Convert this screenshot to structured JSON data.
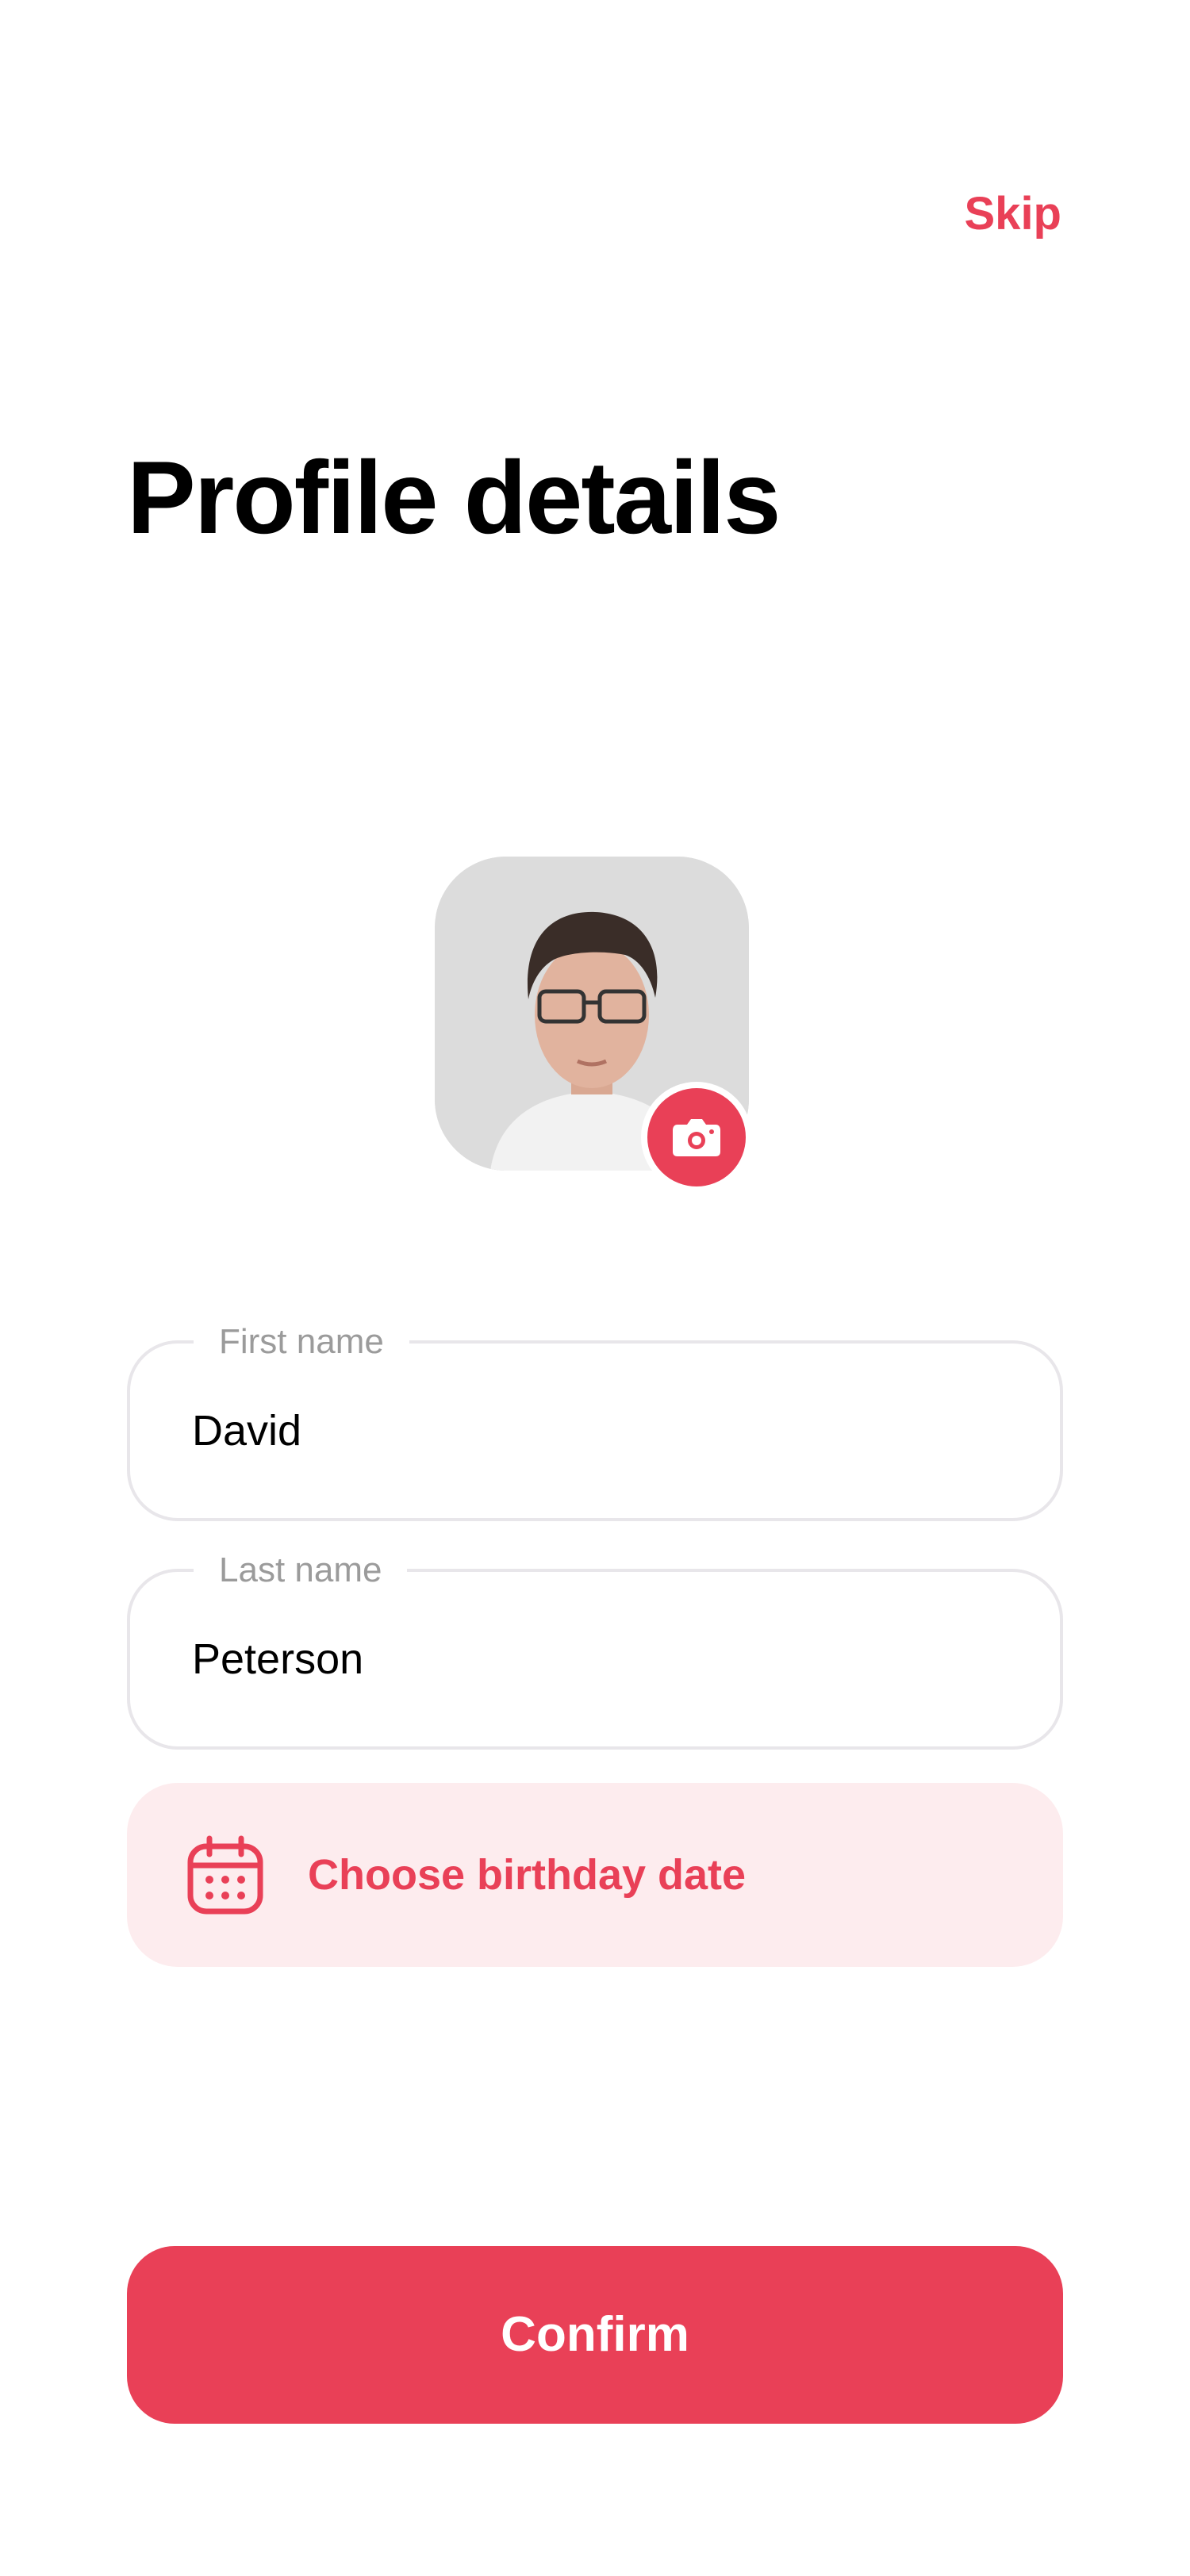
{
  "header": {
    "skip_label": "Skip"
  },
  "page": {
    "title": "Profile details"
  },
  "profile": {
    "avatar_alt": "Profile photo",
    "camera_icon": "camera-icon"
  },
  "form": {
    "first_name": {
      "label": "First name",
      "value": "David"
    },
    "last_name": {
      "label": "Last name",
      "value": "Peterson"
    },
    "birthday": {
      "label": "Choose birthday date",
      "icon": "calendar-icon"
    }
  },
  "actions": {
    "confirm_label": "Confirm"
  },
  "colors": {
    "accent": "#e94057",
    "accent_light": "#fdecee",
    "border": "#e8e6ea",
    "muted_text": "#9b9b9b"
  }
}
